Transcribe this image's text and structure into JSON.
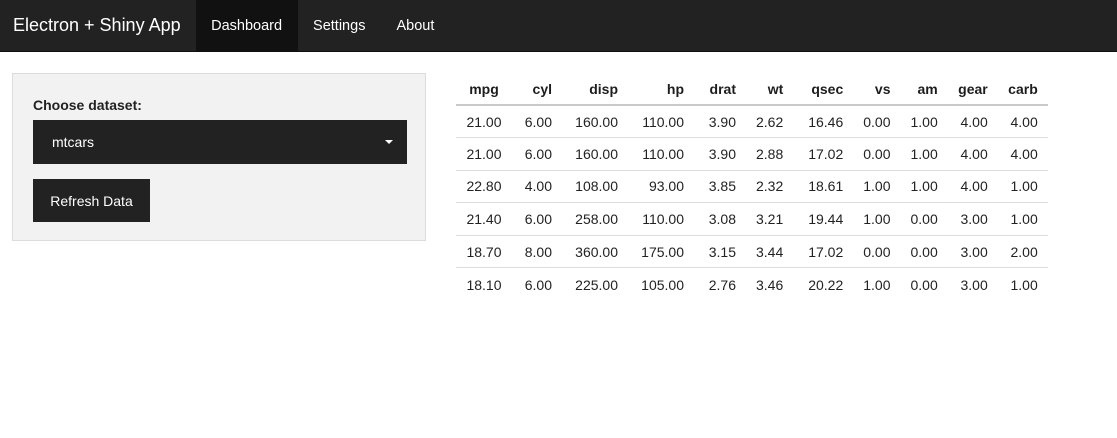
{
  "navbar": {
    "brand": "Electron + Shiny App",
    "items": [
      {
        "label": "Dashboard",
        "active": true
      },
      {
        "label": "Settings",
        "active": false
      },
      {
        "label": "About",
        "active": false
      }
    ]
  },
  "sidebar": {
    "dataset_label": "Choose dataset:",
    "dataset_value": "mtcars",
    "refresh_label": "Refresh Data"
  },
  "table": {
    "columns": [
      "mpg",
      "cyl",
      "disp",
      "hp",
      "drat",
      "wt",
      "qsec",
      "vs",
      "am",
      "gear",
      "carb"
    ],
    "rows": [
      [
        "21.00",
        "6.00",
        "160.00",
        "110.00",
        "3.90",
        "2.62",
        "16.46",
        "0.00",
        "1.00",
        "4.00",
        "4.00"
      ],
      [
        "21.00",
        "6.00",
        "160.00",
        "110.00",
        "3.90",
        "2.88",
        "17.02",
        "0.00",
        "1.00",
        "4.00",
        "4.00"
      ],
      [
        "22.80",
        "4.00",
        "108.00",
        "93.00",
        "3.85",
        "2.32",
        "18.61",
        "1.00",
        "1.00",
        "4.00",
        "1.00"
      ],
      [
        "21.40",
        "6.00",
        "258.00",
        "110.00",
        "3.08",
        "3.21",
        "19.44",
        "1.00",
        "0.00",
        "3.00",
        "1.00"
      ],
      [
        "18.70",
        "8.00",
        "360.00",
        "175.00",
        "3.15",
        "3.44",
        "17.02",
        "0.00",
        "0.00",
        "3.00",
        "2.00"
      ],
      [
        "18.10",
        "6.00",
        "225.00",
        "105.00",
        "2.76",
        "3.46",
        "20.22",
        "1.00",
        "0.00",
        "3.00",
        "1.00"
      ]
    ]
  }
}
